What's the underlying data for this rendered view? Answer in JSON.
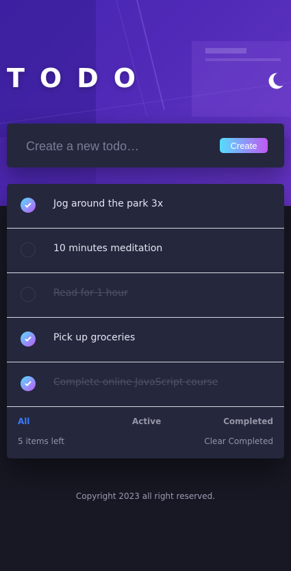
{
  "header": {
    "title": "TODO",
    "theme_toggle_icon": "moon-icon"
  },
  "create": {
    "placeholder": "Create a new todo…",
    "button_label": "Create"
  },
  "todos": [
    {
      "text": "Jog around the park 3x",
      "completed": true,
      "struck": false
    },
    {
      "text": "10 minutes meditation",
      "completed": false,
      "struck": false
    },
    {
      "text": "Read for 1 hour",
      "completed": false,
      "struck": true
    },
    {
      "text": "Pick up groceries",
      "completed": true,
      "struck": false
    },
    {
      "text": "Complete online JavaScript course",
      "completed": true,
      "struck": true
    }
  ],
  "footer": {
    "filters": {
      "all": "All",
      "active": "Active",
      "completed": "Completed"
    },
    "active_filter": "all",
    "items_left": "5 items left",
    "clear_label": "Clear Completed"
  },
  "copyright": "Copyright 2023 all right reserved.",
  "colors": {
    "accent": "#3a7cfd",
    "gradient_start": "#55ddff",
    "gradient_end": "#c058f3",
    "card": "#25273d",
    "background": "#181824"
  }
}
